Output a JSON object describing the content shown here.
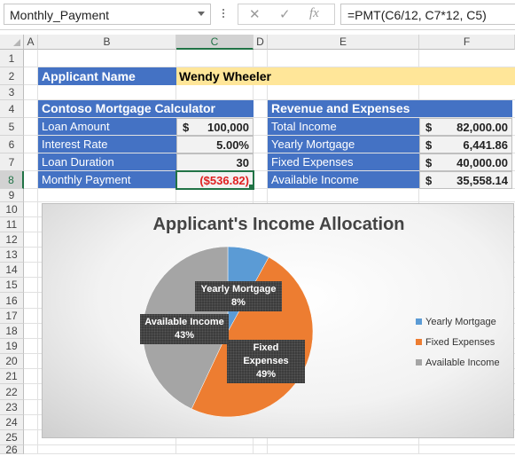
{
  "namebox": {
    "value": "Monthly_Payment"
  },
  "formula_bar": {
    "cancel_icon": "✕",
    "enter_icon": "✓",
    "fx_label": "fx",
    "formula": "=PMT(C6/12, C7*12, C5)"
  },
  "columns": [
    "A",
    "B",
    "C",
    "D",
    "E",
    "F"
  ],
  "selected_column": "C",
  "rows": [
    "1",
    "2",
    "3",
    "4",
    "5",
    "6",
    "7",
    "8",
    "9",
    "10",
    "11",
    "12",
    "13",
    "14",
    "15",
    "16",
    "17",
    "18",
    "19",
    "20",
    "21",
    "22",
    "23",
    "24",
    "25",
    "26"
  ],
  "selected_row": "8",
  "applicant": {
    "label": "Applicant Name",
    "name": "Wendy Wheeler"
  },
  "calculator": {
    "title": "Contoso Mortgage Calculator",
    "rows": [
      {
        "label": "Loan Amount",
        "currency": "$",
        "value": "100,000"
      },
      {
        "label": "Interest Rate",
        "currency": "",
        "value": "5.00%"
      },
      {
        "label": "Loan Duration",
        "currency": "",
        "value": "30"
      },
      {
        "label": "Monthly  Payment",
        "currency": "",
        "value": "($536.82)"
      }
    ]
  },
  "revenue": {
    "title": "Revenue and Expenses",
    "rows": [
      {
        "label": "Total Income",
        "currency": "$",
        "value": "82,000.00"
      },
      {
        "label": "Yearly Mortgage",
        "currency": "$",
        "value": "6,441.86"
      },
      {
        "label": "Fixed Expenses",
        "currency": "$",
        "value": "40,000.00"
      },
      {
        "label": "Available Income",
        "currency": "$",
        "value": "35,558.14"
      }
    ]
  },
  "chart_data": {
    "type": "pie",
    "title": "Applicant's Income Allocation",
    "categories": [
      "Yearly Mortgage",
      "Fixed Expenses",
      "Available Income"
    ],
    "values": [
      8,
      49,
      43
    ],
    "data_labels": [
      {
        "name": "Yearly Mortgage",
        "pct": "8%"
      },
      {
        "name": "Fixed Expenses",
        "pct": "49%"
      },
      {
        "name": "Available Income",
        "pct": "43%"
      }
    ],
    "colors": [
      "#5b9bd5",
      "#ed7d31",
      "#a5a5a5"
    ],
    "legend_position": "right"
  }
}
